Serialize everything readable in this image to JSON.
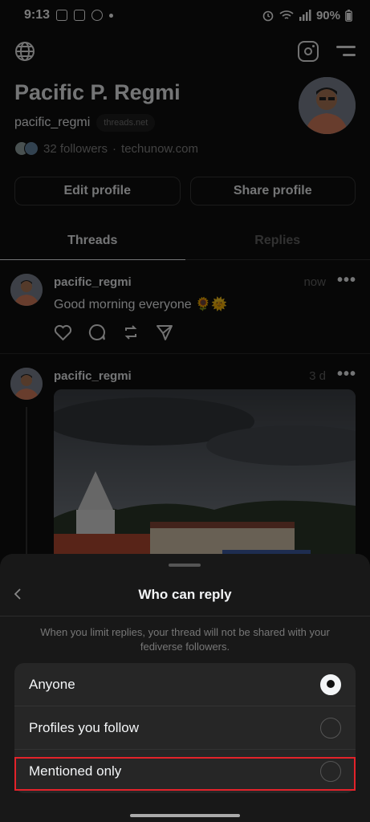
{
  "status_bar": {
    "time": "9:13",
    "battery": "90%"
  },
  "profile": {
    "name": "Pacific P. Regmi",
    "handle": "pacific_regmi",
    "domain_chip": "threads.net",
    "followers": "32 followers",
    "separator": "·",
    "link": "techunow.com",
    "edit_label": "Edit profile",
    "share_label": "Share profile"
  },
  "tabs": [
    {
      "label": "Threads"
    },
    {
      "label": "Replies"
    }
  ],
  "posts": [
    {
      "user": "pacific_regmi",
      "time": "now",
      "text": "Good morning everyone 🌻🌞",
      "more": "•••"
    },
    {
      "user": "pacific_regmi",
      "time": "3 d",
      "more": "•••"
    }
  ],
  "sheet": {
    "title": "Who can reply",
    "note": "When you limit replies, your thread will not be shared with your fediverse followers.",
    "options": [
      {
        "label": "Anyone",
        "selected": true
      },
      {
        "label": "Profiles you follow",
        "selected": false
      },
      {
        "label": "Mentioned only",
        "selected": false
      }
    ],
    "highlight_color": "#e3222a"
  },
  "icons": [
    "globe-icon",
    "instagram-icon",
    "menu-icon",
    "heart-icon",
    "comment-icon",
    "repost-icon",
    "share-icon",
    "back-icon"
  ]
}
